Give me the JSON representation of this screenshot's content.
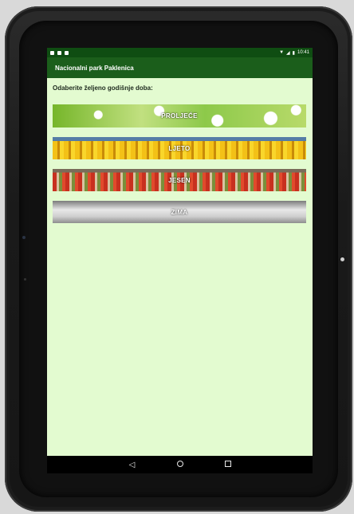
{
  "app": {
    "title": "Nacionalni park Paklenica",
    "prompt": "Odaberite željeno godišnje doba:"
  },
  "status": {
    "time": "10:41",
    "icons": [
      "sim-icon",
      "nfc-icon",
      "sd-icon"
    ],
    "right_icons": [
      "wifi-icon",
      "signal-icon",
      "battery-icon"
    ]
  },
  "seasons": [
    {
      "label": "PROLJEĆE"
    },
    {
      "label": "LJETO"
    },
    {
      "label": "JESEN"
    },
    {
      "label": "ZIMA"
    }
  ],
  "nav": {
    "icons": [
      "back-icon",
      "home-icon",
      "recents-icon"
    ]
  },
  "colors": {
    "appbar": "#1b5e1b",
    "statusbar": "#0f4d12",
    "background": "#e3fbd0"
  }
}
